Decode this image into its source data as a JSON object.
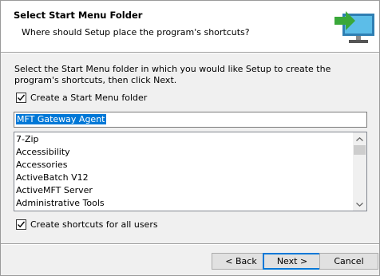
{
  "header": {
    "title": "Select Start Menu Folder",
    "subtitle": "Where should Setup place the program's shortcuts?",
    "icon": "computer-with-arrow-icon"
  },
  "instructions": "Select the Start Menu folder in which you would like Setup to create the program's shortcuts, then click Next.",
  "create_folder": {
    "label": "Create a Start Menu folder",
    "checked": true
  },
  "folder_input": {
    "value": "MFT Gateway Agent"
  },
  "folder_list": {
    "items": [
      "7-Zip",
      "Accessibility",
      "Accessories",
      "ActiveBatch V12",
      "ActiveMFT Server",
      "Administrative Tools"
    ]
  },
  "all_users": {
    "label": "Create shortcuts for all users",
    "checked": true
  },
  "buttons": {
    "back": "< Back",
    "next": "Next >",
    "cancel": "Cancel"
  },
  "colors": {
    "accent": "#0078d7",
    "icon_green": "#3aa83a",
    "icon_monitor": "#3a9fcf"
  }
}
